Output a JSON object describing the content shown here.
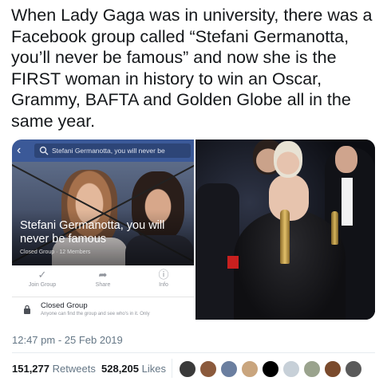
{
  "tweet": {
    "text": "When Lady Gaga was in university, there was a Facebook group called “Stefani Germanotta, you’ll never be famous” and now she is the FIRST woman in history to win an Oscar, Grammy, BAFTA and Golden Globe all in the same year.",
    "timestamp": "12:47 pm - 25 Feb 2019"
  },
  "stats": {
    "retweets_count": "151,277",
    "retweets_label": "Retweets",
    "likes_count": "528,205",
    "likes_label": "Likes"
  },
  "facebook": {
    "search_text": "Stefani Germanotta, you will never be",
    "group_name": "Stefani Germanotta, you will never be famous",
    "group_meta": "Closed Group · 12 Members",
    "actions": [
      {
        "label": "Join Group",
        "icon": "check-icon"
      },
      {
        "label": "Share",
        "icon": "share-arrow-icon"
      },
      {
        "label": "Info",
        "icon": "info-icon"
      }
    ],
    "closed_title": "Closed Group",
    "closed_desc": "Anyone can find the group and see who's in it. Only"
  },
  "avatars": [
    {
      "icon": "avatar-1",
      "color": "#3a3a3a"
    },
    {
      "icon": "avatar-2",
      "color": "#8b5a3c"
    },
    {
      "icon": "avatar-3",
      "color": "#6b7fa0"
    },
    {
      "icon": "avatar-4",
      "color": "#c9a57e"
    },
    {
      "icon": "avatar-5",
      "color": "#000000"
    },
    {
      "icon": "avatar-6",
      "color": "#c7d0d8"
    },
    {
      "icon": "avatar-7",
      "color": "#9aa38d"
    },
    {
      "icon": "avatar-8",
      "color": "#7a4a2c"
    },
    {
      "icon": "avatar-9",
      "color": "#5a5a5a"
    }
  ],
  "colors": {
    "facebook_blue": "#3b5998",
    "muted_text": "#657786"
  }
}
